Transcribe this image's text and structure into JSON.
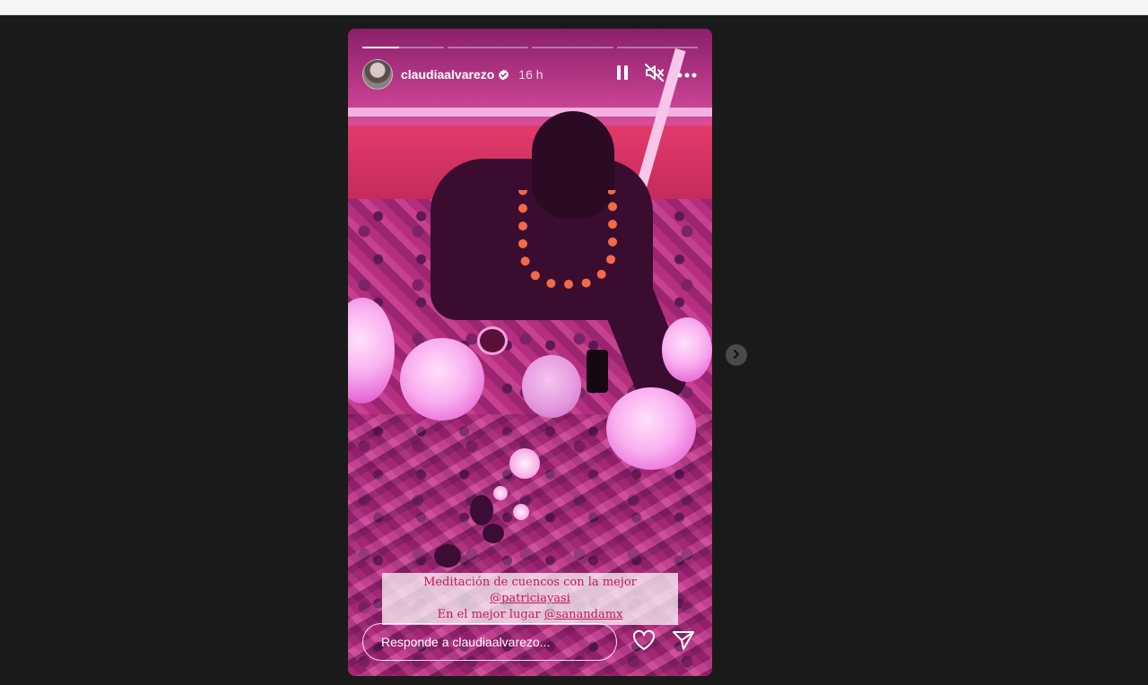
{
  "story": {
    "username": "claudiaalvarezo",
    "time_ago": "16 h",
    "verified": true,
    "segments": [
      0.45,
      0,
      0,
      0
    ],
    "caption": {
      "line1_text": "Meditación de cuencos con la mejor ",
      "line1_mention": "@patriciayasi",
      "line2_text": "En el mejor lugar ",
      "line2_mention": "@sanandamx"
    },
    "reply_placeholder": "Responde a claudiaalvarezo...",
    "icons": {
      "pause": "pause-icon",
      "mute": "speaker-muted-icon",
      "more": "more-icon",
      "like": "heart-icon",
      "share": "send-icon",
      "next": "chevron-right-icon"
    }
  }
}
